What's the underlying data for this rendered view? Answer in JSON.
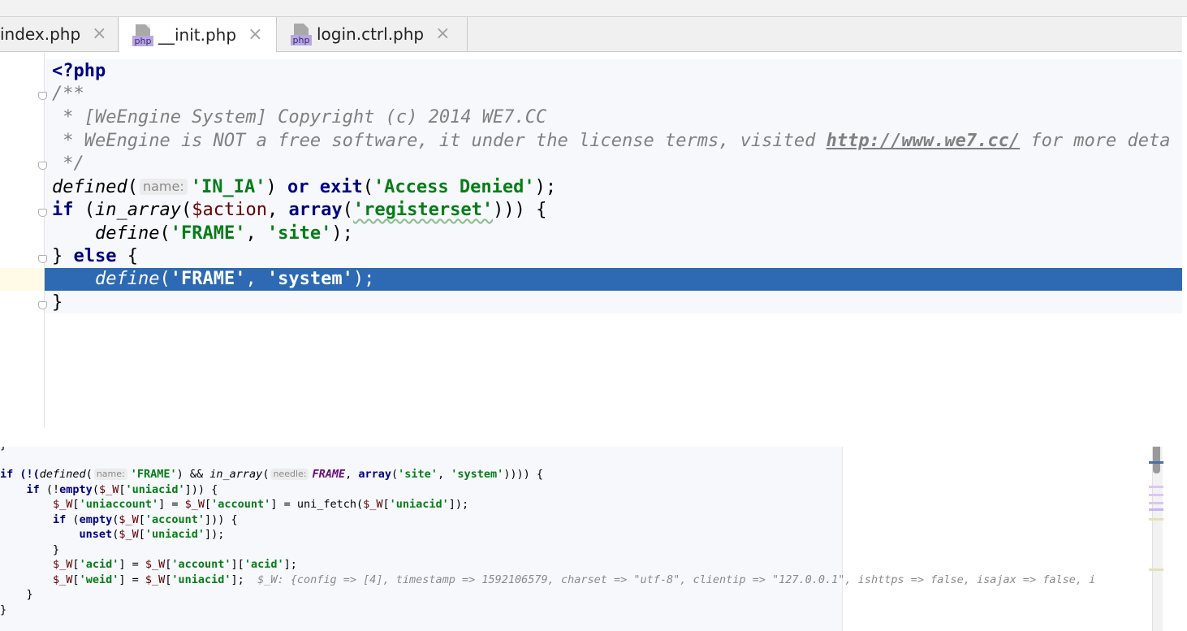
{
  "tabs": [
    {
      "label": "index.php",
      "icon": "php-file-icon",
      "active": false
    },
    {
      "label": "__init.php",
      "icon": "php-file-icon",
      "active": true
    },
    {
      "label": "login.ctrl.php",
      "icon": "php-file-icon",
      "active": false
    }
  ],
  "file_badge": "php",
  "close_glyph": "×",
  "top_code": {
    "l1": "<?php",
    "l2": "/**",
    "l3a": " * [WeEngine System] Copyright (c) 2014 WE7.CC",
    "l4a": " * WeEngine is NOT a free software, it under the license terms, visited ",
    "l4url": "http://www.we7.cc/",
    "l4b": " for more deta",
    "l5": " */",
    "l6_fn": "defined",
    "l6_p1": "(",
    "l6_hint": "name:",
    "l6_arg": "'IN_IA'",
    "l6_p2": ") ",
    "l6_or": "or",
    "l6_sp": " ",
    "l6_exit": "exit",
    "l6_p3": "(",
    "l6_msg": "'Access Denied'",
    "l6_p4": ");",
    "l7_if": "if",
    "l7_p1": " (",
    "l7_fn": "in_array",
    "l7_p2": "(",
    "l7_var": "$action",
    "l7_p3": ", ",
    "l7_arr": "array",
    "l7_p4": "(",
    "l7_str": "'registerset'",
    "l7_p5": "))) {",
    "l8_ind": "    ",
    "l8_fn": "define",
    "l8_p1": "(",
    "l8_s1": "'FRAME'",
    "l8_p2": ", ",
    "l8_s2": "'site'",
    "l8_p3": ");",
    "l9_a": "} ",
    "l9_else": "else",
    "l9_b": " {",
    "l10_ind": "    ",
    "l10_fn": "define",
    "l10_p1": "(",
    "l10_s1": "'FRAME'",
    "l10_p2": ", ",
    "l10_s2": "'system'",
    "l10_p3": ");",
    "l11": "}"
  },
  "bottom_code": {
    "b0": "}",
    "b1_a": "if (!(",
    "b1_fn": "defined",
    "b1_p": "(",
    "b1_hint": "name:",
    "b1_s": "'FRAME'",
    "b1_b": ") && ",
    "b1_fn2": "in_array",
    "b1_p2": "(",
    "b1_hint2": "needle:",
    "b1_const": "FRAME",
    "b1_c": ", ",
    "b1_arr": "array",
    "b1_d": "(",
    "b1_s2": "'site'",
    "b1_e": ", ",
    "b1_s3": "'system'",
    "b1_f": ")))) {",
    "b2_a": "    ",
    "b2_if": "if",
    "b2_b": " (!",
    "b2_empty": "empty",
    "b2_c": "(",
    "b2_var": "$_W",
    "b2_d": "[",
    "b2_s": "'uniacid'",
    "b2_e": "])) {",
    "b3_a": "        ",
    "b3_var": "$_W",
    "b3_b": "[",
    "b3_s": "'uniaccount'",
    "b3_c": "] = ",
    "b3_var2": "$_W",
    "b3_d": "[",
    "b3_s2": "'account'",
    "b3_e": "] = uni_fetch(",
    "b3_var3": "$_W",
    "b3_f": "[",
    "b3_s3": "'uniacid'",
    "b3_g": "]);",
    "b4_a": "        ",
    "b4_if": "if",
    "b4_b": " (",
    "b4_empty": "empty",
    "b4_c": "(",
    "b4_var": "$_W",
    "b4_d": "[",
    "b4_s": "'account'",
    "b4_e": "])) {",
    "b5_a": "            ",
    "b5_unset": "unset",
    "b5_b": "(",
    "b5_var": "$_W",
    "b5_c": "[",
    "b5_s": "'uniacid'",
    "b5_d": "]);",
    "b6": "        }",
    "b7_a": "        ",
    "b7_var": "$_W",
    "b7_b": "[",
    "b7_s": "'acid'",
    "b7_c": "] = ",
    "b7_var2": "$_W",
    "b7_d": "[",
    "b7_s2": "'account'",
    "b7_e": "][",
    "b7_s3": "'acid'",
    "b7_f": "];",
    "b8_a": "        ",
    "b8_var": "$_W",
    "b8_b": "[",
    "b8_s": "'weid'",
    "b8_c": "] = ",
    "b8_var2": "$_W",
    "b8_d": "[",
    "b8_s2": "'uniacid'",
    "b8_e": "];",
    "b8_dbg": "  $_W: {config => [4], timestamp => 1592106579, charset => \"utf-8\", clientip => \"127.0.0.1\", ishttps => false, isajax => false, i",
    "b9": "    }",
    "b10": "}"
  },
  "colors": {
    "keyword": "#000080",
    "string": "#067d17",
    "variable": "#660000",
    "comment": "#808080",
    "selection": "#2d6ab3",
    "constant": "#660e7a"
  }
}
